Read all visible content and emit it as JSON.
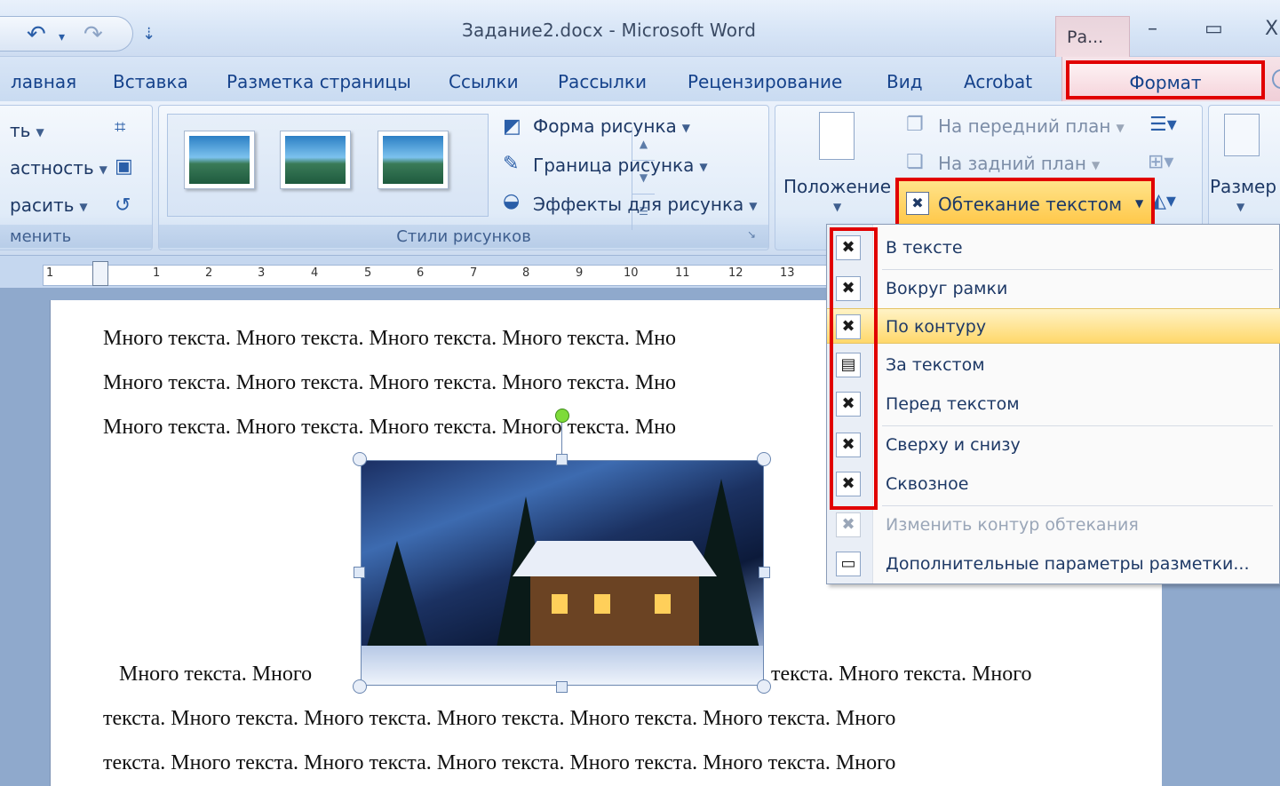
{
  "window": {
    "title": "Задание2.docx - Microsoft Word",
    "contextual_tab_label": "Ра...",
    "minimize": "–",
    "maximize": "▭",
    "close": "X"
  },
  "qat": {
    "undo": "↶",
    "redo": "↷",
    "customize": "⇣"
  },
  "tabs": [
    "лавная",
    "Вставка",
    "Разметка страницы",
    "Ссылки",
    "Рассылки",
    "Рецензирование",
    "Вид",
    "Acrobat"
  ],
  "active_tab": "Формат",
  "ribbon": {
    "adjust": {
      "items": [
        "ть",
        "астность",
        "расить"
      ],
      "label": "менить"
    },
    "picture_styles": {
      "label": "Стили рисунков",
      "shape": "Форма рисунка",
      "border": "Граница рисунка",
      "effects": "Эффекты для рисунка"
    },
    "arrange": {
      "position": "Положение",
      "bring_front": "На передний план",
      "send_back": "На задний план",
      "text_wrap": "Обтекание текстом"
    },
    "size": {
      "label": "Размер"
    }
  },
  "ruler": {
    "numbers": [
      "1",
      "1",
      "2",
      "3",
      "4",
      "5",
      "6",
      "7",
      "8",
      "9",
      "10",
      "11",
      "12",
      "13"
    ]
  },
  "document": {
    "lines_top": [
      "Много текста. Много текста. Много текста. Много текста. Мно",
      "Много текста. Много текста. Много текста. Много текста. Мно",
      "Много текста. Много текста. Много текста. Много текста. Мно"
    ],
    "line_beside_left": "Много текста. Много",
    "line_beside_right": "текста. Много текста. Много",
    "lines_bottom": [
      "текста. Много текста. Много текста. Много текста. Много текста. Много текста. Много",
      "текста. Много текста. Много текста. Много текста. Много текста. Много текста. Много"
    ]
  },
  "wrap_menu": {
    "items": [
      {
        "label": "В тексте",
        "icon": "wrap-inline-icon"
      },
      {
        "label": "Вокруг рамки",
        "icon": "wrap-square-icon"
      },
      {
        "label": "По контуру",
        "icon": "wrap-tight-icon"
      },
      {
        "label": "За текстом",
        "icon": "wrap-behind-icon"
      },
      {
        "label": "Перед текстом",
        "icon": "wrap-front-icon"
      },
      {
        "label": "Сверху и снизу",
        "icon": "wrap-top-bottom-icon"
      },
      {
        "label": "Сквозное",
        "icon": "wrap-through-icon"
      },
      {
        "label": "Изменить контур обтекания",
        "icon": "edit-wrap-points-icon"
      },
      {
        "label": "Дополнительные параметры разметки...",
        "icon": "more-layout-options-icon"
      }
    ],
    "highlighted": "По контуру"
  },
  "colors": {
    "accent_red": "#e10000",
    "hover": "#ffd86b",
    "ribbon_text": "#15428b"
  }
}
